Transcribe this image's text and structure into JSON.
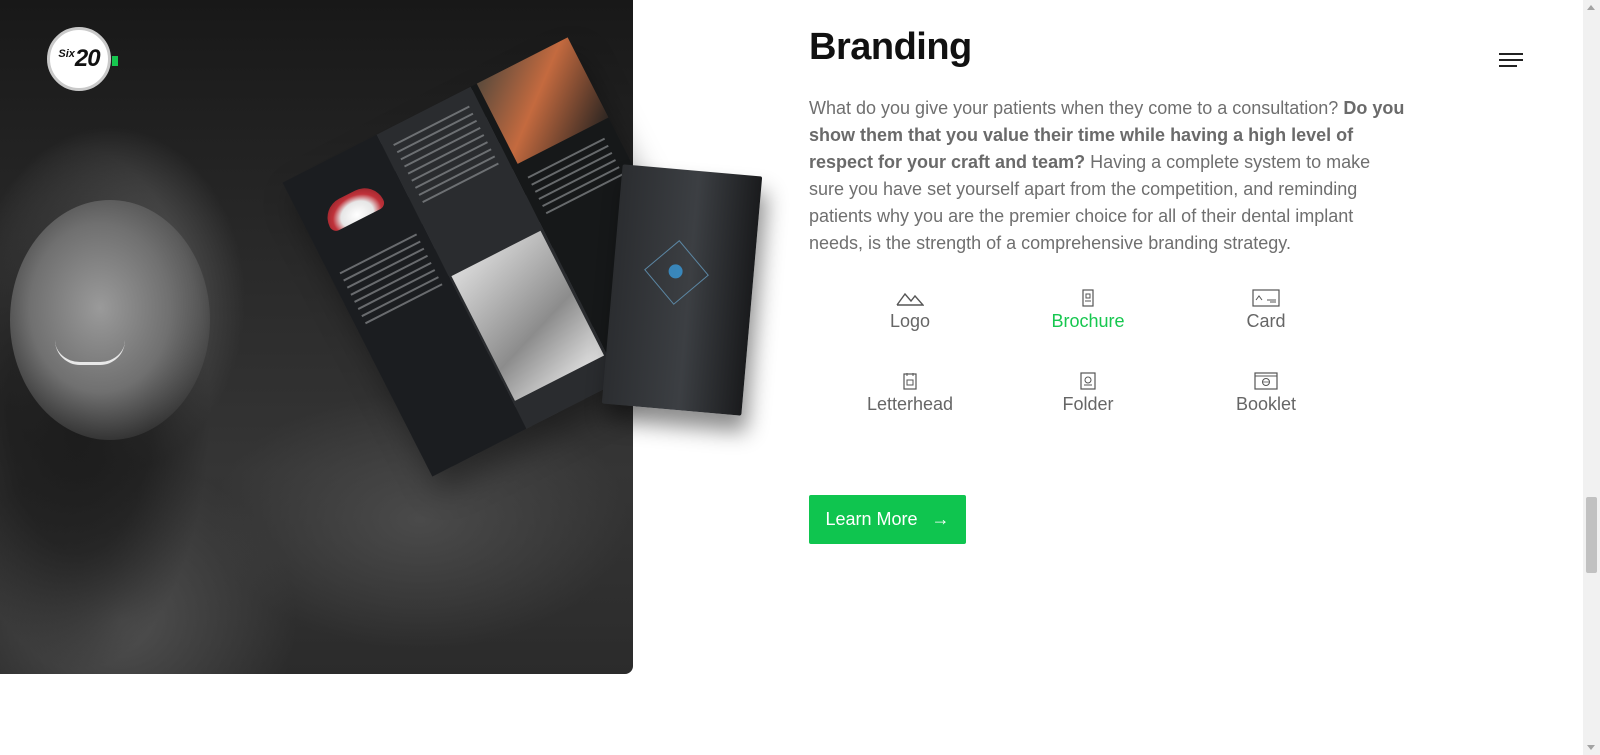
{
  "logo": {
    "prefix": "Six",
    "number": "20"
  },
  "section": {
    "title": "Branding",
    "description": {
      "part1": "What do you give your patients when they come to a consultation? ",
      "bold": "Do you show them that you value their time while having a high level of respect for your craft and team?",
      "part2": " Having a complete system to make sure you have set yourself apart from the competition, and reminding patients why you are the premier choice for all of their dental implant needs, is the strength of a comprehensive branding strategy."
    }
  },
  "services": [
    {
      "label": "Logo",
      "icon": "mountain-icon"
    },
    {
      "label": "Brochure",
      "icon": "brochure-icon",
      "active": true
    },
    {
      "label": "Card",
      "icon": "card-icon"
    },
    {
      "label": "Letterhead",
      "icon": "letterhead-icon"
    },
    {
      "label": "Folder",
      "icon": "folder-icon"
    },
    {
      "label": "Booklet",
      "icon": "booklet-icon"
    }
  ],
  "cta": {
    "label": "Learn More",
    "icon": "arrow-right-icon"
  },
  "colors": {
    "accent": "#0fc54f",
    "heading": "#111111",
    "body_text": "#6f6f6f",
    "panel": "#2b2b2b"
  },
  "menu": {
    "icon": "hamburger-menu-icon"
  }
}
